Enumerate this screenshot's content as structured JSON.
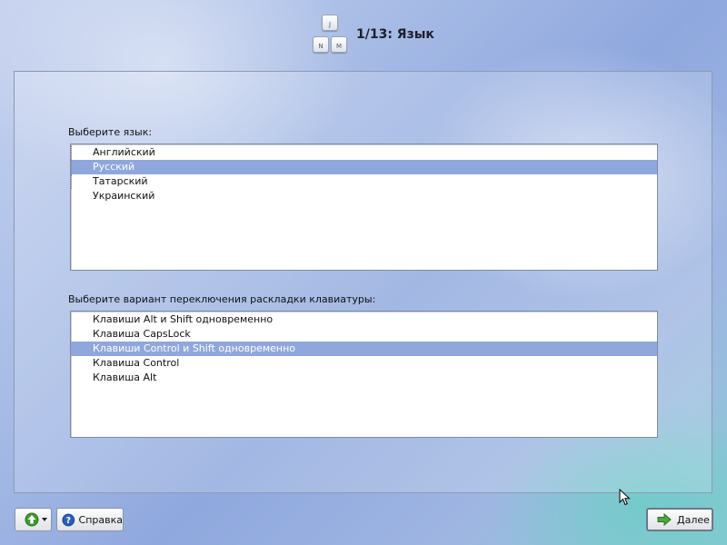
{
  "header": {
    "logo_keys": [
      "J",
      "N",
      "M"
    ],
    "title": "1/13: Язык"
  },
  "language": {
    "label": "Выберите язык:",
    "items": [
      {
        "label": "Английский",
        "selected": false
      },
      {
        "label": "Русский",
        "selected": true
      },
      {
        "label": "Татарский",
        "selected": false
      },
      {
        "label": "Украинский",
        "selected": false
      }
    ]
  },
  "layout_switch": {
    "label": "Выберите вариант переключения раскладки клавиатуры:",
    "items": [
      {
        "label": "Клавиши Alt и Shift одновременно",
        "selected": false
      },
      {
        "label": "Клавиша CapsLock",
        "selected": false
      },
      {
        "label": "Клавиши Control и Shift одновременно",
        "selected": true
      },
      {
        "label": "Клавиша Control",
        "selected": false
      },
      {
        "label": "Клавиша Alt",
        "selected": false
      }
    ]
  },
  "footer": {
    "menu_button_icon": "green-up-arrow-icon",
    "help_label": "Справка",
    "help_icon": "help-question-icon",
    "next_label": "Далее",
    "next_icon": "green-right-arrow-icon"
  },
  "colors": {
    "selection": "#8fa7dd",
    "accent_green": "#3f9a2e",
    "help_blue": "#2a5fb8"
  }
}
